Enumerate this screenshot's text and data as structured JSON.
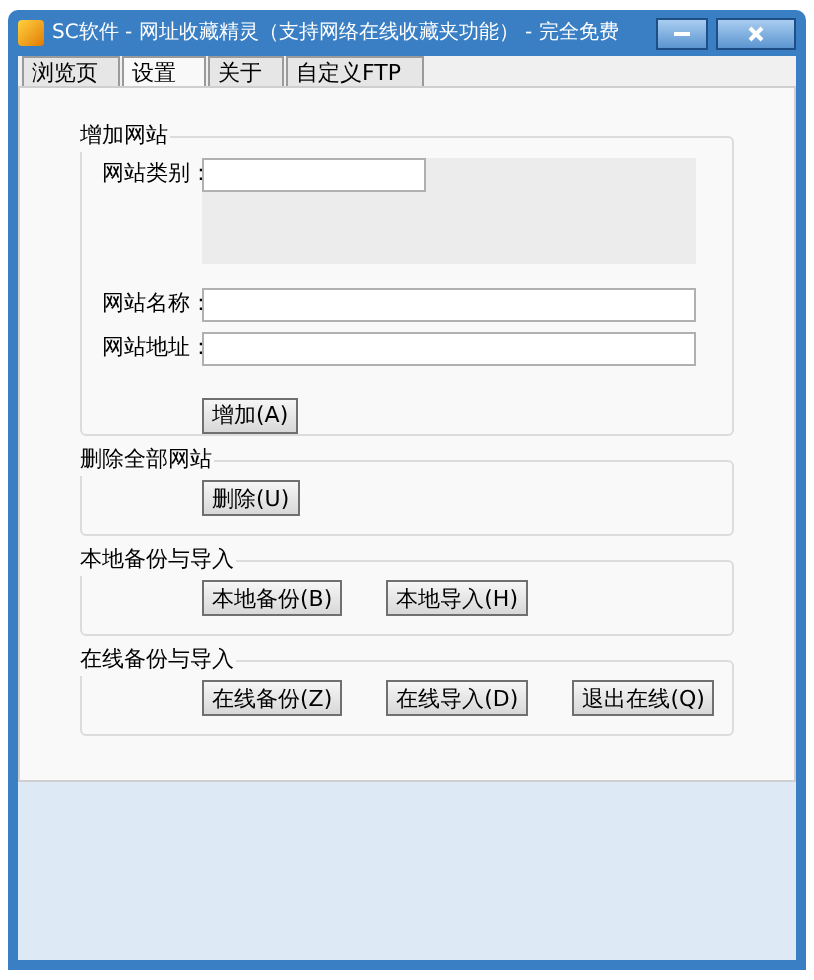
{
  "window": {
    "title": "SC软件 - 网址收藏精灵（支持网络在线收藏夹功能） - 完全免费"
  },
  "tabs": [
    {
      "label": "浏览页",
      "selected": false
    },
    {
      "label": "设置",
      "selected": true
    },
    {
      "label": "关于",
      "selected": false
    },
    {
      "label": "自定义FTP",
      "selected": false
    }
  ],
  "add_site": {
    "title": "增加网站",
    "category_label": "网站类别：",
    "name_label": "网站名称：",
    "url_label": "网站地址：",
    "button": "增加(A)"
  },
  "groups": [
    {
      "title": "删除全部网站",
      "buttons": [
        "删除(U)"
      ]
    },
    {
      "title": "本地备份与导入",
      "buttons": [
        "本地备份(B)",
        "本地导入(H)"
      ]
    },
    {
      "title": "在线备份与导入",
      "buttons": [
        "在线备份(Z)",
        "在线导入(D)",
        "退出在线(Q)"
      ]
    }
  ]
}
